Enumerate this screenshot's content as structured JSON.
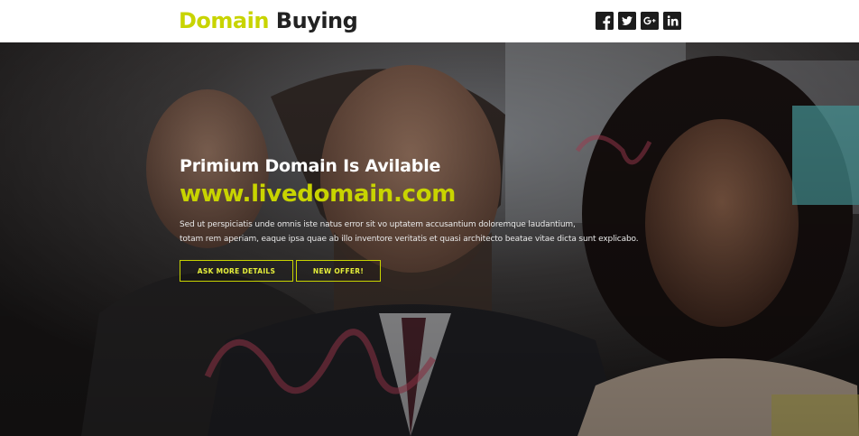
{
  "header": {
    "logo_part1": "Domain",
    "logo_part2": "Buying",
    "social": [
      {
        "name": "facebook-icon",
        "glyph": "f"
      },
      {
        "name": "twitter-icon",
        "glyph": "t"
      },
      {
        "name": "google-plus-icon",
        "glyph": "G+"
      },
      {
        "name": "linkedin-icon",
        "glyph": "in"
      }
    ]
  },
  "hero": {
    "headline": "Primium Domain Is Avilable",
    "domain": "www.livedomain.com",
    "description_line1": "Sed ut perspiciatis unde omnis iste natus error sit vo uptatem accusantium doloremque laudantium,",
    "description_line2": "totam rem aperiam, eaque ipsa quae ab illo inventore veritatis et quasi architecto beatae vitae dicta sunt explicabo.",
    "button_details": "ASK MORE DETAILS",
    "button_offer": "NEW OFFER!"
  },
  "colors": {
    "accent": "#c8d400",
    "dark": "#222222",
    "white": "#ffffff"
  }
}
